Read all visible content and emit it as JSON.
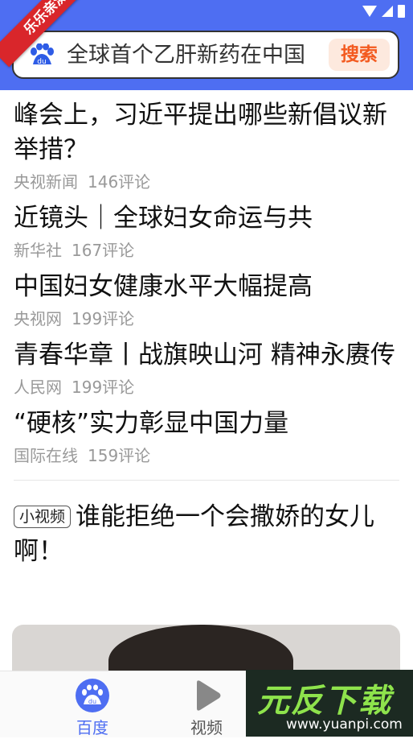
{
  "ribbon": {
    "text": "乐乐亲测"
  },
  "search": {
    "query": "全球首个乙肝新药在中国",
    "button": "搜索"
  },
  "colors": {
    "accent": "#4e6ef2",
    "search_button_text": "#f35a1f",
    "ribbon": "#d9262b"
  },
  "feed": [
    {
      "title": "峰会上，习近平提出哪些新倡议新举措？",
      "source": "央视新闻",
      "comments": "146评论"
    },
    {
      "title": "近镜头｜全球妇女命运与共",
      "source": "新华社",
      "comments": "167评论"
    },
    {
      "title": "中国妇女健康水平大幅提高",
      "source": "央视网",
      "comments": "199评论"
    },
    {
      "title": "青春华章丨战旗映山河 精神永赓传",
      "source": "人民网",
      "comments": "199评论"
    },
    {
      "title": "“硬核”实力彰显中国力量",
      "source": "国际在线",
      "comments": "159评论"
    }
  ],
  "video": {
    "badge": "小视频",
    "title": "谁能拒绝一个会撒娇的女儿啊！"
  },
  "nav": [
    {
      "label": "百度",
      "icon": "baidu-paw-icon",
      "active": true
    },
    {
      "label": "视频",
      "icon": "play-icon",
      "active": false
    }
  ],
  "watermark": {
    "main": "元反下载",
    "sub": "www.yuanpi.com"
  }
}
